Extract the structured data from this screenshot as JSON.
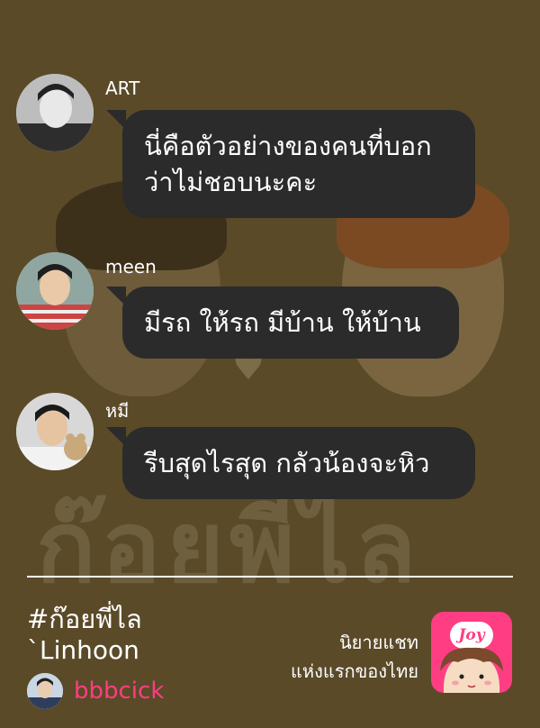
{
  "messages": [
    {
      "sender": "ART",
      "lines": [
        "นี่คือตัวอย่างของคนที่บอก",
        "ว่าไม่ชอบนะคะ"
      ]
    },
    {
      "sender": "meen",
      "lines": [
        "มีรถ ให้รถ มีบ้าน ให้บ้าน"
      ]
    },
    {
      "sender": "หมี",
      "lines": [
        "รีบสุดไรสุด กลัวน้องจะหิว"
      ]
    }
  ],
  "footer": {
    "hashtag": "#ก๊อยพี่ไล",
    "author": "`Linhoon",
    "username": "bbbcick",
    "tagline": [
      "นิยายแชท",
      "แห่งแรกของไทย"
    ],
    "app_logo_text": "Joy"
  },
  "background": {
    "watermark_text": "ก๊อยพี่ไล"
  },
  "colors": {
    "background": "#5a4a28",
    "bubble": "#2b2b2b",
    "accent_pink": "#ff3d83",
    "text": "#ffffff"
  }
}
